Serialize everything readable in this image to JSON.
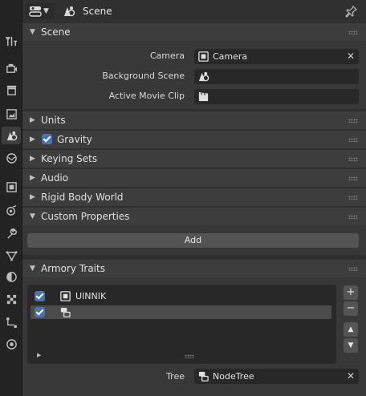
{
  "header": {
    "context_label": "Scene"
  },
  "panels": {
    "scene": {
      "title": "Scene",
      "camera": {
        "label": "Camera",
        "value": "Camera"
      },
      "background_scene": {
        "label": "Background Scene",
        "value": ""
      },
      "active_movie_clip": {
        "label": "Active Movie Clip",
        "value": ""
      }
    },
    "units": {
      "title": "Units"
    },
    "gravity": {
      "title": "Gravity",
      "checked": true
    },
    "keying_sets": {
      "title": "Keying Sets"
    },
    "audio": {
      "title": "Audio"
    },
    "rigid_body_world": {
      "title": "Rigid Body World"
    },
    "custom_properties": {
      "title": "Custom Properties",
      "add_label": "Add"
    },
    "armory_traits": {
      "title": "Armory Traits",
      "items": [
        {
          "label": "UINNIK",
          "enabled": true,
          "icon": "object-icon",
          "selected": false
        },
        {
          "label": "",
          "enabled": true,
          "icon": "node-tree-icon",
          "selected": true
        }
      ],
      "add_symbol": "+",
      "remove_symbol": "−",
      "up_symbol": "▲",
      "down_symbol": "▼",
      "tree": {
        "label": "Tree",
        "value": "NodeTree"
      }
    }
  },
  "colors": {
    "accent": "#4772b3",
    "panel_header": "#3d3d3d",
    "panel_body": "#383838",
    "field": "#282828",
    "tab_strip": "#232323"
  }
}
